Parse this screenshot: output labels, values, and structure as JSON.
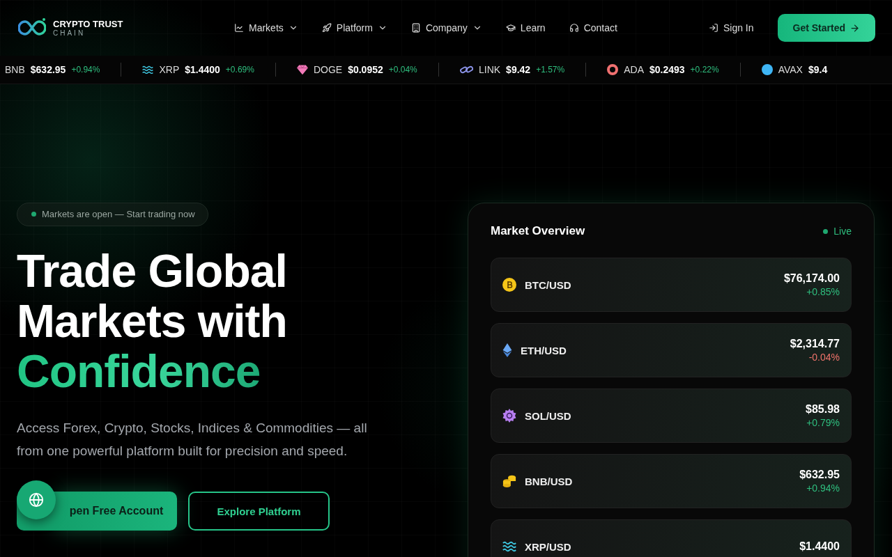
{
  "brand": {
    "name": "CRYPTO TRUST",
    "subtitle": "CHAIN"
  },
  "nav": [
    {
      "label": "Markets",
      "kind": "chart",
      "dropdown": true
    },
    {
      "label": "Platform",
      "kind": "rocket",
      "dropdown": true
    },
    {
      "label": "Company",
      "kind": "building",
      "dropdown": true
    },
    {
      "label": "Learn",
      "kind": "cap",
      "dropdown": false
    },
    {
      "label": "Contact",
      "kind": "headset",
      "dropdown": false
    }
  ],
  "sign_in": "Sign In",
  "get_started": "Get Started",
  "ticker": [
    {
      "symbol": "BNB",
      "price": "$632.95",
      "change": "+0.94%",
      "kind": "plain"
    },
    {
      "symbol": "XRP",
      "price": "$1.4400",
      "change": "+0.69%",
      "kind": "waves"
    },
    {
      "symbol": "DOGE",
      "price": "$0.0952",
      "change": "+0.04%",
      "kind": "gem"
    },
    {
      "symbol": "LINK",
      "price": "$9.42",
      "change": "+1.57%",
      "kind": "link"
    },
    {
      "symbol": "ADA",
      "price": "$0.2493",
      "change": "+0.22%",
      "kind": "ring"
    },
    {
      "symbol": "AVAX",
      "price": "$9.4",
      "kind": "dot"
    }
  ],
  "hero": {
    "badge": "Markets are open — Start trading now",
    "title_lines": [
      "Trade Global",
      "Markets with"
    ],
    "title_accent": "Confidence",
    "description": "Access Forex, Crypto, Stocks, Indices & Commodities — all from one powerful platform built for precision and speed.",
    "primary_button": "pen Free Account",
    "secondary_button": "Explore Platform"
  },
  "market": {
    "title": "Market Overview",
    "status": "Live",
    "rows": [
      {
        "pair": "BTC/USD",
        "price": "$76,174.00",
        "change": "+0.85%",
        "color": "#2fbf7f",
        "kind": "btc"
      },
      {
        "pair": "ETH/USD",
        "price": "$2,314.77",
        "change": "-0.04%",
        "color": "#f0736b",
        "kind": "eth"
      },
      {
        "pair": "SOL/USD",
        "price": "$85.98",
        "change": "+0.79%",
        "color": "#2fbf7f",
        "kind": "sol"
      },
      {
        "pair": "BNB/USD",
        "price": "$632.95",
        "change": "+0.94%",
        "color": "#2fbf7f",
        "kind": "coins"
      },
      {
        "pair": "XRP/USD",
        "price": "$1.4400",
        "kind": "waves"
      }
    ]
  }
}
